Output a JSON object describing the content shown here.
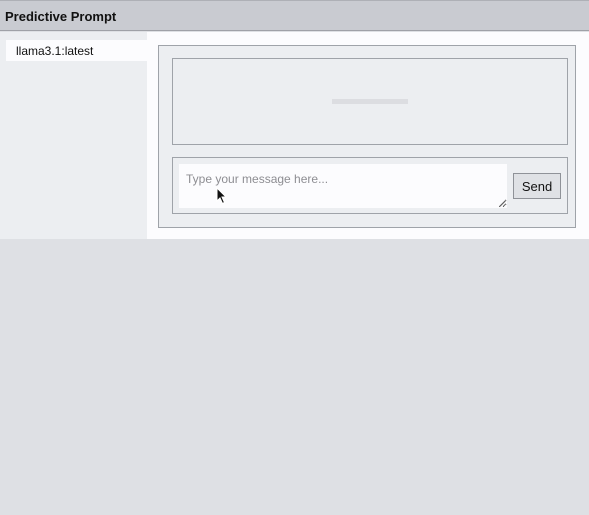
{
  "window": {
    "title": "Predictive Prompt"
  },
  "sidebar": {
    "models": [
      {
        "label": "llama3.1:latest"
      }
    ]
  },
  "chat": {
    "input": {
      "value": "",
      "placeholder": "Type your message here..."
    },
    "send_label": "Send"
  },
  "icons": {
    "cursor": "mouse-pointer-icon",
    "resize": "resize-grip-icon"
  }
}
